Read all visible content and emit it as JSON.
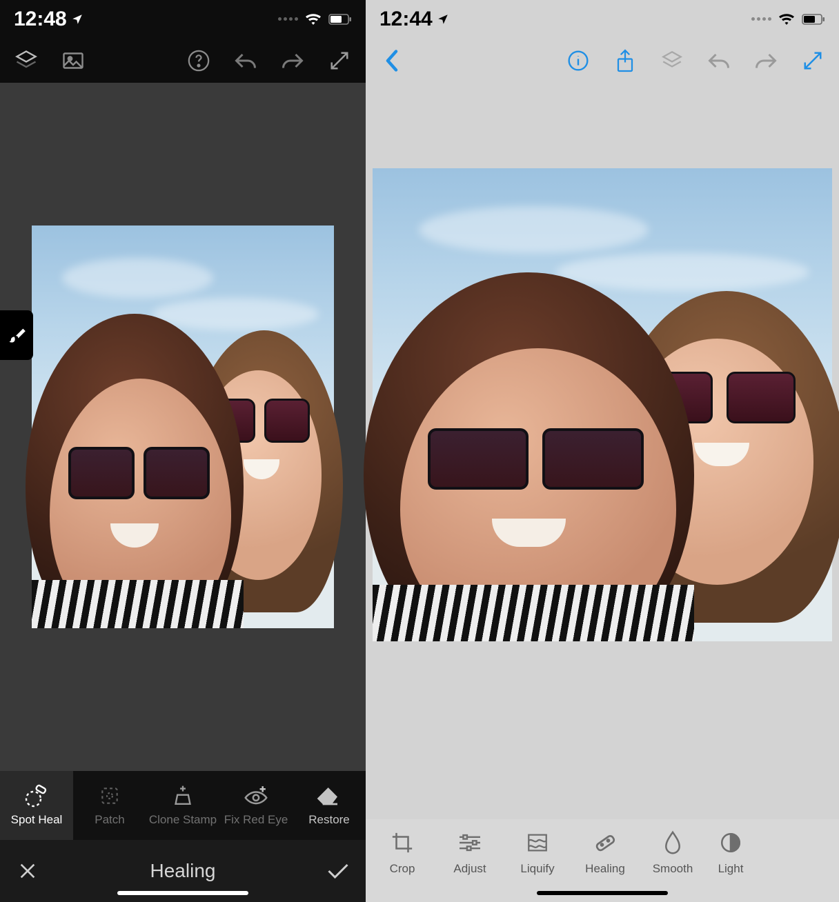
{
  "left": {
    "status": {
      "time": "12:48"
    },
    "side_tool": "brush",
    "tools": [
      {
        "id": "spot-heal",
        "label": "Spot Heal",
        "active": true
      },
      {
        "id": "patch",
        "label": "Patch",
        "active": false
      },
      {
        "id": "clone",
        "label": "Clone Stamp",
        "active": false
      },
      {
        "id": "redeye",
        "label": "Fix Red Eye",
        "active": false
      },
      {
        "id": "restore",
        "label": "Restore",
        "active": false
      }
    ],
    "action_title": "Healing"
  },
  "right": {
    "status": {
      "time": "12:44"
    },
    "tools": [
      {
        "id": "crop",
        "label": "Crop"
      },
      {
        "id": "adjust",
        "label": "Adjust"
      },
      {
        "id": "liquify",
        "label": "Liquify"
      },
      {
        "id": "healing",
        "label": "Healing"
      },
      {
        "id": "smooth",
        "label": "Smooth"
      },
      {
        "id": "light",
        "label": "Light"
      }
    ]
  },
  "colors": {
    "accent_blue": "#1f8fe5"
  }
}
